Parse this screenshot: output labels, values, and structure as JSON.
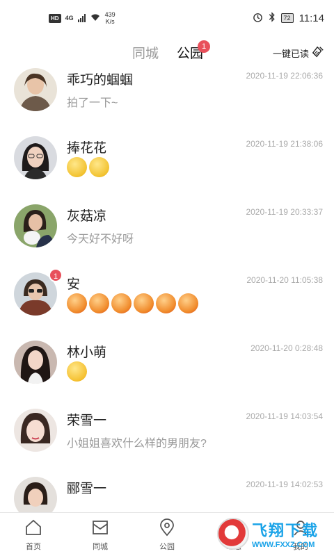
{
  "status_bar": {
    "hd": "HD",
    "network": "4G",
    "speed_value": "439",
    "speed_unit": "K/s",
    "battery": "72",
    "time": "11:14"
  },
  "header": {
    "tab_city": "同城",
    "tab_park": "公园",
    "tab_park_badge": "1",
    "read_all": "一键已读"
  },
  "messages": [
    {
      "name": "乖巧的蝈蝈",
      "time": "2020-11-19 22:06:36",
      "preview": "拍了一下~",
      "badge": "",
      "emoji_type": "",
      "emoji_count": 0
    },
    {
      "name": "捧花花",
      "time": "2020-11-19 21:38:06",
      "preview": "",
      "badge": "",
      "emoji_type": "confused",
      "emoji_count": 2
    },
    {
      "name": "灰菇凉",
      "time": "2020-11-19 20:33:37",
      "preview": "今天好不好呀",
      "badge": "",
      "emoji_type": "",
      "emoji_count": 0
    },
    {
      "name": "安",
      "time": "2020-11-20 11:05:38",
      "preview": "",
      "badge": "1",
      "emoji_type": "angry",
      "emoji_count": 6
    },
    {
      "name": "林小萌",
      "time": "2020-11-20 0:28:48",
      "preview": "",
      "badge": "",
      "emoji_type": "love",
      "emoji_count": 1
    },
    {
      "name": "荣雪一",
      "time": "2020-11-19 14:03:54",
      "preview": "小姐姐喜欢什么样的男朋友?",
      "badge": "",
      "emoji_type": "",
      "emoji_count": 0
    },
    {
      "name": "郦雪一",
      "time": "2020-11-19 14:02:53",
      "preview": "",
      "badge": "",
      "emoji_type": "",
      "emoji_count": 0
    }
  ],
  "bottom_nav": {
    "home": "首页",
    "city": "同城",
    "park": "公园",
    "dynamic": "动态",
    "me": "我的"
  },
  "watermark": {
    "title": "飞翔下载",
    "url": "WWW.FXXZ.COM"
  },
  "colors": {
    "badge": "#e8505b",
    "muted_text": "#999999",
    "time_text": "#aaaaaa",
    "watermark": "#1aa3e8"
  }
}
